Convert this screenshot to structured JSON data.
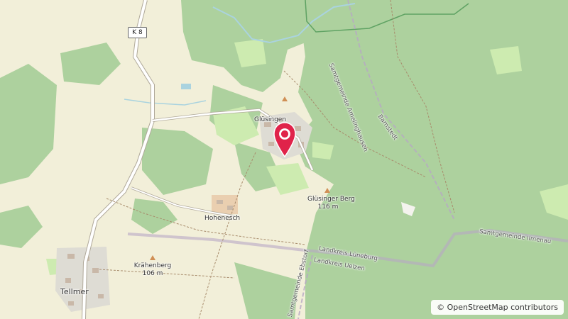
{
  "map": {
    "road_shield": "K 8",
    "places": {
      "glusingen": "Glüsingen",
      "hohenesch": "Hohenesch",
      "tellmer": "Tellmer"
    },
    "peaks": [
      {
        "name": "Glüsinger Berg",
        "elevation": "116 m"
      },
      {
        "name": "Krähenberg",
        "elevation": "106 m"
      }
    ],
    "boundary_labels": {
      "amelinghausen": "Samtgemeinde Amelinghausen",
      "barnstedt": "Barnstedt",
      "ilmenau": "Samtgemeinde Ilmenau",
      "luneburg": "Landkreis Lüneburg",
      "uelzen": "Landkreis Uelzen",
      "ebstorf": "Samtgemeinde Ebstorf"
    },
    "attribution": "© OpenStreetMap contributors",
    "colors": {
      "farmland": "#f2efd9",
      "forest": "#add19e",
      "meadow": "#cdebb0",
      "water": "#aad3df",
      "pin": "#e0234a"
    }
  }
}
